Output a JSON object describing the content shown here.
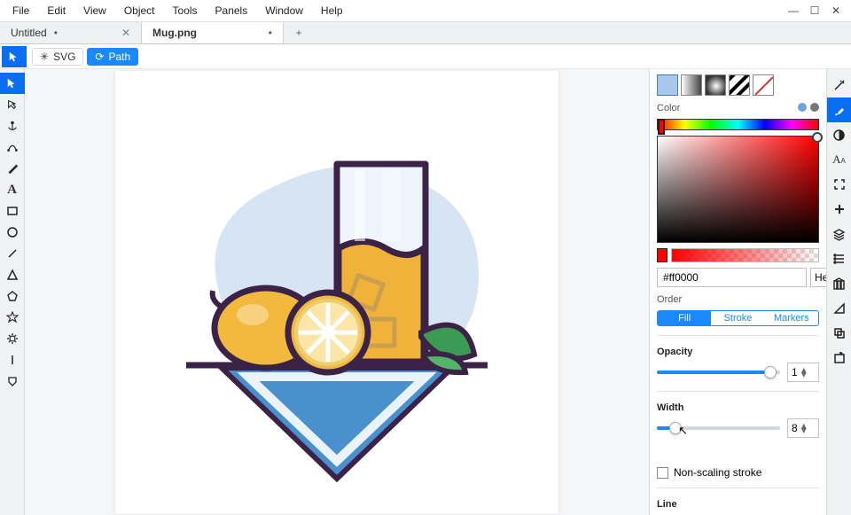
{
  "menu": {
    "items": [
      "File",
      "Edit",
      "View",
      "Object",
      "Tools",
      "Panels",
      "Window",
      "Help"
    ]
  },
  "tabs": [
    {
      "label": "Untitled",
      "dirty": true,
      "active": false
    },
    {
      "label": "Mug.png",
      "dirty": true,
      "active": true
    }
  ],
  "context": {
    "chips": [
      {
        "label": "SVG",
        "active": false
      },
      {
        "label": "Path",
        "active": true
      }
    ]
  },
  "left_tools": [
    "select-tool",
    "node-tool",
    "anchor-tool",
    "curve-tool",
    "pen-tool",
    "text-tool",
    "rect-tool",
    "ellipse-tool",
    "line-tool",
    "triangle-tool",
    "polygon-tool",
    "star-tool",
    "gear-tool",
    "vline-tool",
    "shape-tool"
  ],
  "right_tools": [
    "wand-icon",
    "brush-icon",
    "contrast-icon",
    "text-panel-icon",
    "fullscreen-icon",
    "add-icon",
    "layers-icon",
    "list-icon",
    "library-icon",
    "slant-icon",
    "path-ops-icon",
    "export-icon"
  ],
  "panel": {
    "swatches": [
      "flat",
      "linear",
      "radial",
      "pattern",
      "none"
    ],
    "color_label": "Color",
    "hex": "#ff0000",
    "format": "Hex",
    "order_label": "Order",
    "order_segments": [
      "Fill",
      "Stroke",
      "Markers"
    ],
    "order_active": 0,
    "opacity_label": "Opacity",
    "opacity_value": "1",
    "width_label": "Width",
    "width_value": "8",
    "nonscaling_label": "Non-scaling stroke",
    "line_label": "Line"
  }
}
